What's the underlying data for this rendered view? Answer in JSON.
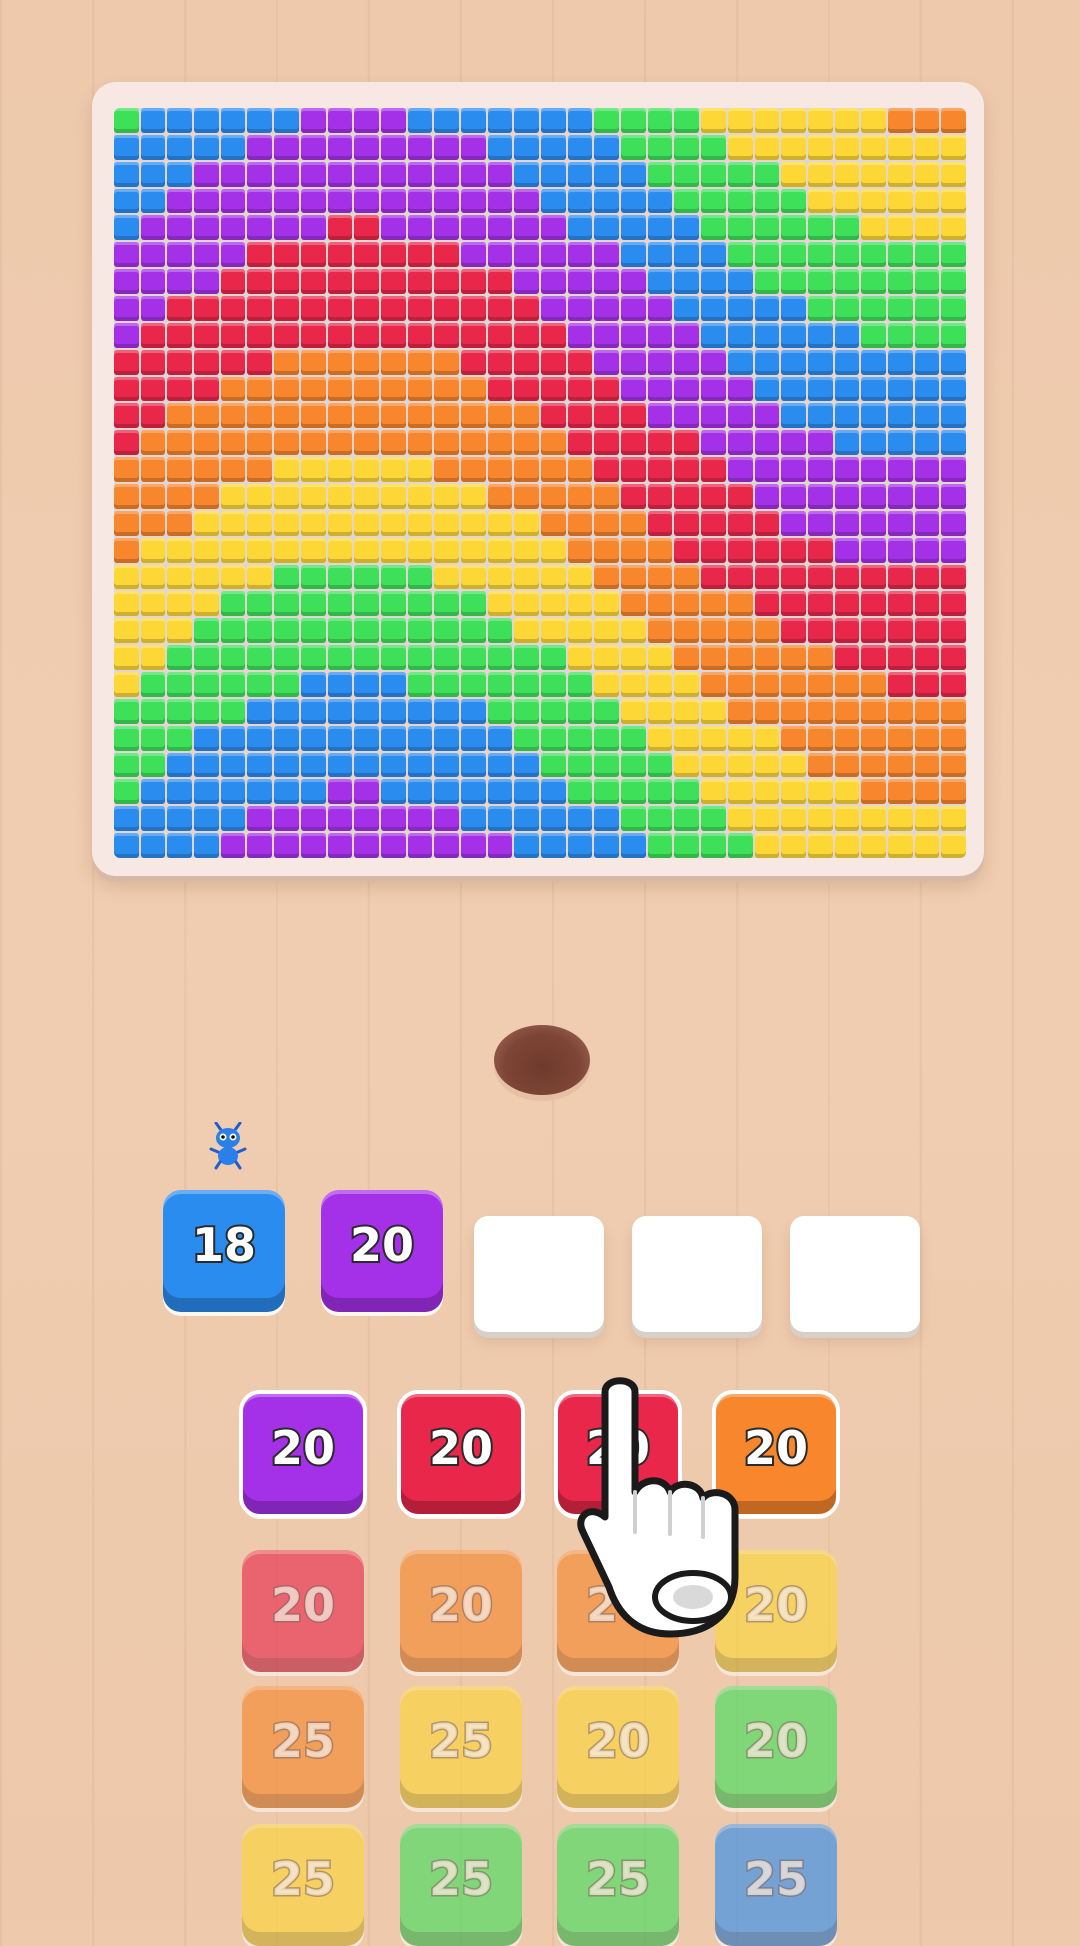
{
  "colors": {
    "red": "#e8274a",
    "orange": "#f7862c",
    "yellow": "#fcd736",
    "green": "#3ee05a",
    "blue": "#2b8cf0",
    "purple": "#a430e8",
    "wood": "#eec9ac"
  },
  "board": {
    "name": "rainbow-wave-pixel-art"
  },
  "queue": [
    {
      "value": "18",
      "color": "#2b8cf0"
    },
    {
      "value": "20",
      "color": "#a430e8"
    }
  ],
  "empty_slots": 3,
  "grid": [
    {
      "row": 1,
      "col": 1,
      "value": "20",
      "color": "#a430e8",
      "active": true
    },
    {
      "row": 1,
      "col": 2,
      "value": "20",
      "color": "#e8274a",
      "active": true
    },
    {
      "row": 1,
      "col": 3,
      "value": "20",
      "color": "#e8274a",
      "active": true
    },
    {
      "row": 1,
      "col": 4,
      "value": "20",
      "color": "#f7862c",
      "active": true
    },
    {
      "row": 2,
      "col": 1,
      "value": "20",
      "color": "#e8274a",
      "active": false
    },
    {
      "row": 2,
      "col": 2,
      "value": "20",
      "color": "#f7862c",
      "active": false
    },
    {
      "row": 2,
      "col": 3,
      "value": "20",
      "color": "#f7862c",
      "active": false
    },
    {
      "row": 2,
      "col": 4,
      "value": "20",
      "color": "#fcd736",
      "active": false
    },
    {
      "row": 3,
      "col": 1,
      "value": "25",
      "color": "#f7862c",
      "active": false
    },
    {
      "row": 3,
      "col": 2,
      "value": "25",
      "color": "#fcd736",
      "active": false
    },
    {
      "row": 3,
      "col": 3,
      "value": "20",
      "color": "#fcd736",
      "active": false
    },
    {
      "row": 3,
      "col": 4,
      "value": "20",
      "color": "#3ee05a",
      "active": false
    },
    {
      "row": 4,
      "col": 1,
      "value": "25",
      "color": "#fcd736",
      "active": false
    },
    {
      "row": 4,
      "col": 2,
      "value": "25",
      "color": "#3ee05a",
      "active": false
    },
    {
      "row": 4,
      "col": 3,
      "value": "25",
      "color": "#3ee05a",
      "active": false
    },
    {
      "row": 4,
      "col": 4,
      "value": "25",
      "color": "#2b8cf0",
      "active": false
    }
  ]
}
